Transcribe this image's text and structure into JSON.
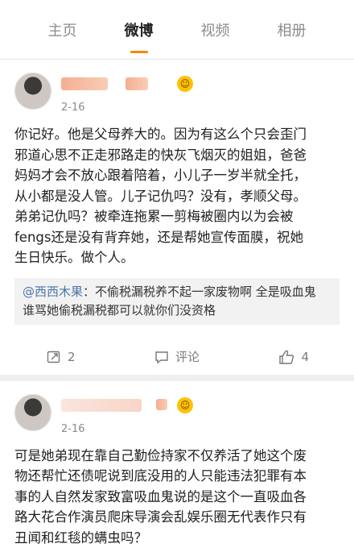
{
  "tabs": [
    {
      "label": "主页"
    },
    {
      "label": "微博"
    },
    {
      "label": "视频"
    },
    {
      "label": "相册"
    }
  ],
  "post1": {
    "date": "2-16",
    "text": "你记好。他是父母养大的。因为有这么个只会歪门\n邪道心思不正走邪路走的快灰飞烟灭的姐姐，爸爸\n妈妈才会不放心跟着陪着，小儿子一岁半就全托，\n从小都是没人管。儿子记仇吗？没有，孝顺父母。\n弟弟记仇吗？被牵连拖累一剪梅被圈内以为会被\nfengs还是没有背弃她，还是帮她宣传面膜，祝她\n生日快乐。做个人。",
    "quote_user": "@西西木果",
    "quote_text": "：不偷税漏税养不起一家废物啊 全是吸血鬼\n谁骂她偷税漏税都可以就你们没资格",
    "repost_count": "2",
    "comment_label": "评论",
    "like_count": "4"
  },
  "post2": {
    "date": "2-16",
    "text": "可是她弟现在靠自己勤俭持家不仅养活了她这个废\n物还帮忙还债呢说到底没用的人只能违法犯罪有本\n事的人自然发家致富吸血鬼说的是这个一直吸血各\n路大花合作演员爬床导演会乱娱乐圈无代表作只有\n丑闻和红毯的螨虫吗？"
  },
  "icons": {
    "repost": "repost-icon",
    "comment": "comment-icon",
    "like": "thumbs-up-icon",
    "badge": "emoji-badge-icon"
  },
  "colors": {
    "tab_indicator": "#ff8200",
    "mention": "#4a76a8",
    "quote_bg": "#f2f2f2",
    "separator": "#f0f0f0"
  }
}
